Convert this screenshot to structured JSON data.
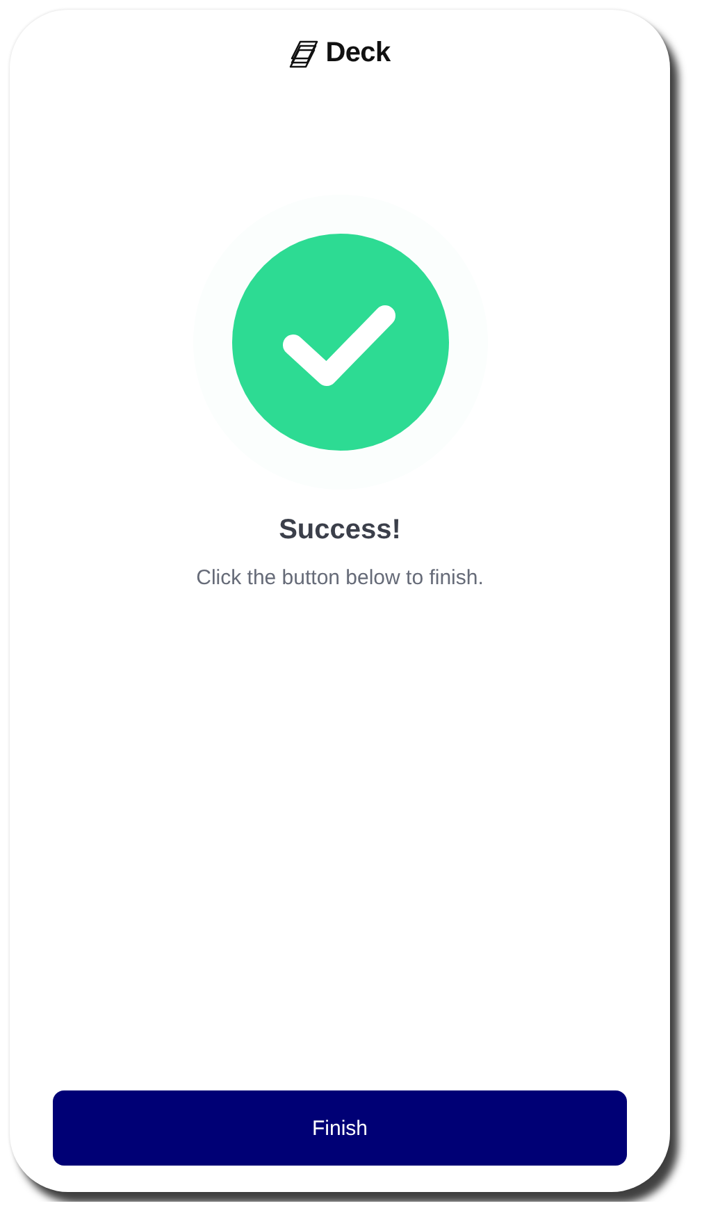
{
  "header": {
    "brand": "Deck"
  },
  "result": {
    "title": "Success!",
    "message": "Click the button below to finish."
  },
  "buttons": [
    {
      "label": "Finish"
    }
  ]
}
